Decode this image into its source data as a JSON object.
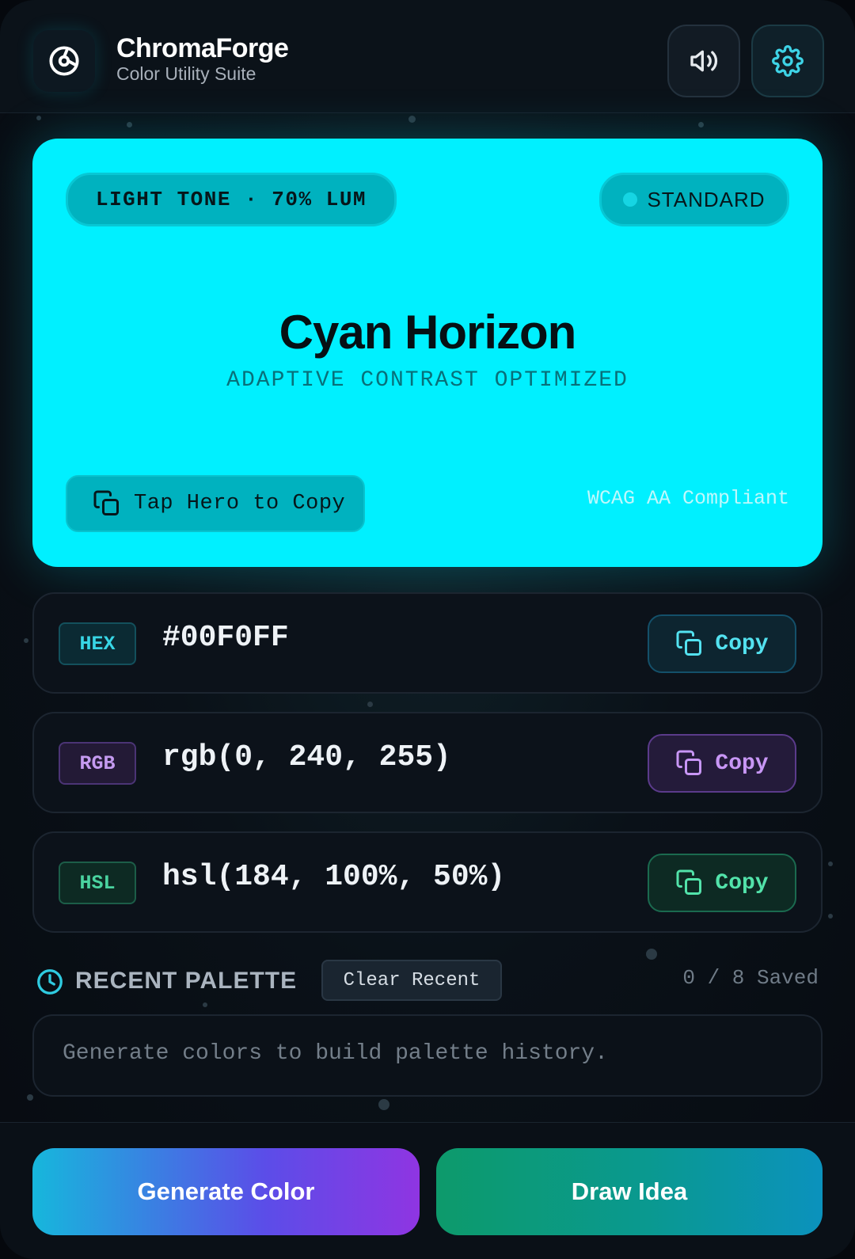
{
  "header": {
    "title": "ChromaForge",
    "subtitle": "Color Utility Suite"
  },
  "hero": {
    "color": "#00F0FF",
    "tone_badge": "LIGHT TONE · 70% LUM",
    "mode_badge": "STANDARD",
    "color_name": "Cyan Horizon",
    "tagline": "ADAPTIVE CONTRAST OPTIMIZED",
    "copy_label": "Tap Hero to Copy",
    "compliance": "WCAG AA Compliant"
  },
  "formats": [
    {
      "tag": "HEX",
      "value": "#00F0FF",
      "copy_label": "Copy",
      "accent": "#38D6E6"
    },
    {
      "tag": "RGB",
      "value": "rgb(0, 240, 255)",
      "copy_label": "Copy",
      "accent": "#C49AF0"
    },
    {
      "tag": "HSL",
      "value": "hsl(184, 100%, 50%)",
      "copy_label": "Copy",
      "accent": "#4AD3A0"
    }
  ],
  "recent": {
    "title": "RECENT PALETTE",
    "clear_label": "Clear Recent",
    "saved_count": "0 / 8 Saved",
    "empty_message": "Generate colors to build palette history."
  },
  "footer": {
    "generate_label": "Generate Color",
    "draw_label": "Draw Idea"
  },
  "icons": {
    "logo": "aperture-icon",
    "sound": "speaker-icon",
    "settings": "gear-icon",
    "copy": "copy-icon",
    "recent": "clock-icon"
  }
}
